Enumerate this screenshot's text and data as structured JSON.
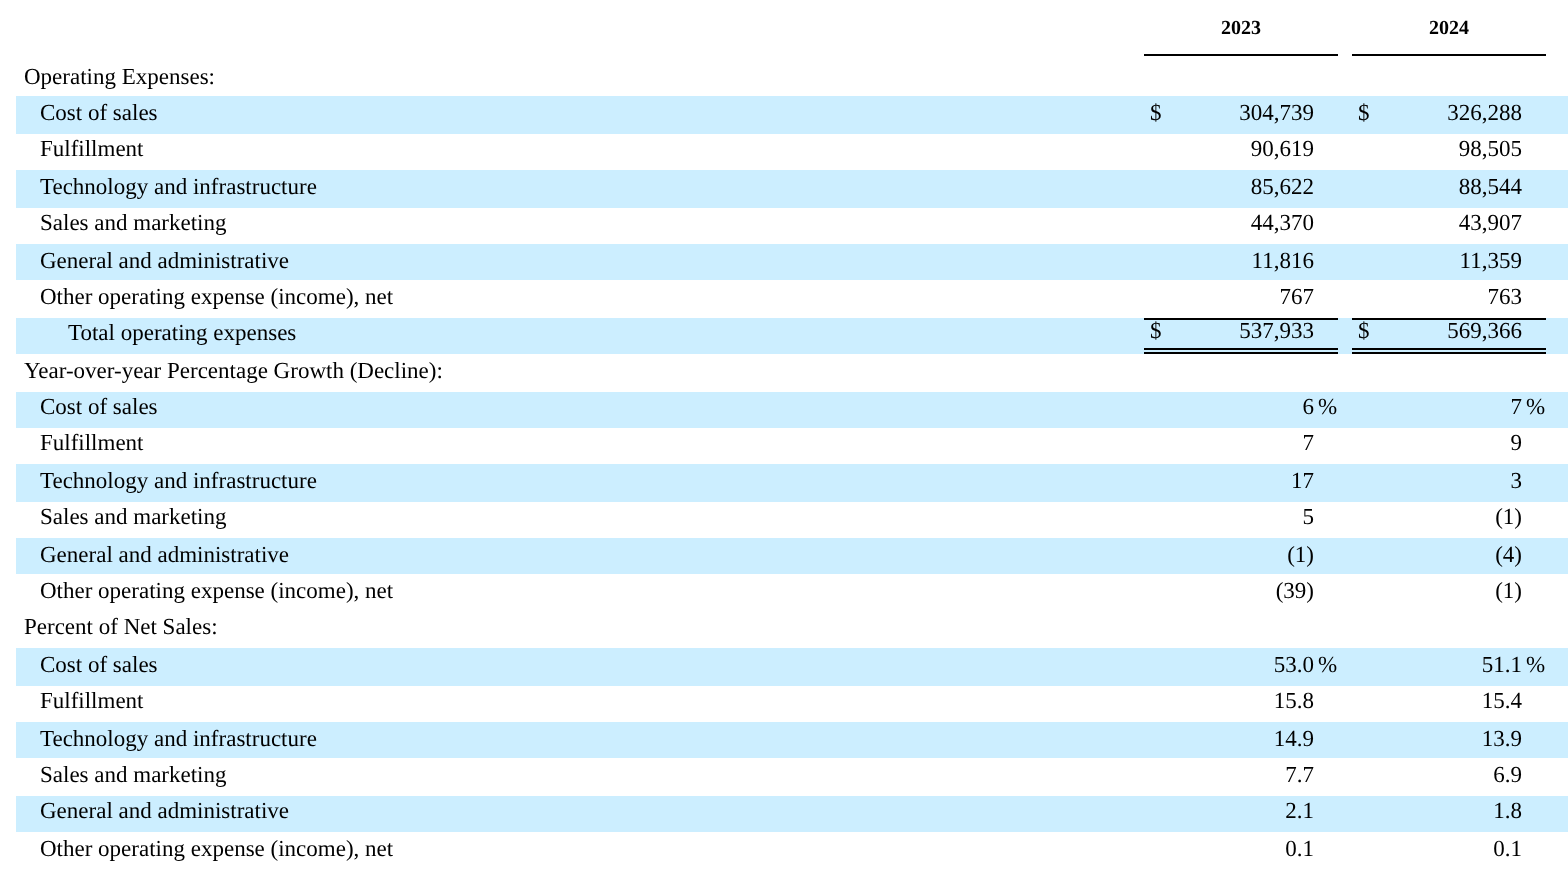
{
  "columns": [
    "2023",
    "2024"
  ],
  "rows": [
    {
      "kind": "section",
      "label": "Operating Expenses:",
      "shaded": false
    },
    {
      "kind": "item",
      "label": "Cost of sales",
      "shaded": true,
      "cells": [
        {
          "currency": "$",
          "value": "304,739"
        },
        {
          "currency": "$",
          "value": "326,288"
        }
      ]
    },
    {
      "kind": "item",
      "label": "Fulfillment",
      "shaded": false,
      "cells": [
        {
          "value": "90,619"
        },
        {
          "value": "98,505"
        }
      ]
    },
    {
      "kind": "item",
      "label": "Technology and infrastructure",
      "shaded": true,
      "cells": [
        {
          "value": "85,622"
        },
        {
          "value": "88,544"
        }
      ]
    },
    {
      "kind": "item",
      "label": "Sales and marketing",
      "shaded": false,
      "cells": [
        {
          "value": "44,370"
        },
        {
          "value": "43,907"
        }
      ]
    },
    {
      "kind": "item",
      "label": "General and administrative",
      "shaded": true,
      "cells": [
        {
          "value": "11,816"
        },
        {
          "value": "11,359"
        }
      ]
    },
    {
      "kind": "item",
      "label": "Other operating expense (income), net",
      "shaded": false,
      "cells": [
        {
          "value": "767"
        },
        {
          "value": "763"
        }
      ]
    },
    {
      "kind": "total",
      "label": "Total operating expenses",
      "shaded": true,
      "cells": [
        {
          "currency": "$",
          "value": "537,933"
        },
        {
          "currency": "$",
          "value": "569,366"
        }
      ]
    },
    {
      "kind": "section",
      "label": "Year-over-year Percentage Growth (Decline):",
      "shaded": false
    },
    {
      "kind": "item",
      "label": "Cost of sales",
      "shaded": true,
      "cells": [
        {
          "value": "6",
          "unit": "%"
        },
        {
          "value": "7",
          "unit": "%"
        }
      ]
    },
    {
      "kind": "item",
      "label": "Fulfillment",
      "shaded": false,
      "cells": [
        {
          "value": "7"
        },
        {
          "value": "9"
        }
      ]
    },
    {
      "kind": "item",
      "label": "Technology and infrastructure",
      "shaded": true,
      "cells": [
        {
          "value": "17"
        },
        {
          "value": "3"
        }
      ]
    },
    {
      "kind": "item",
      "label": "Sales and marketing",
      "shaded": false,
      "cells": [
        {
          "value": "5"
        },
        {
          "value": "(1)"
        }
      ]
    },
    {
      "kind": "item",
      "label": "General and administrative",
      "shaded": true,
      "cells": [
        {
          "value": "(1)"
        },
        {
          "value": "(4)"
        }
      ]
    },
    {
      "kind": "item",
      "label": "Other operating expense (income), net",
      "shaded": false,
      "cells": [
        {
          "value": "(39)"
        },
        {
          "value": "(1)"
        }
      ]
    },
    {
      "kind": "section",
      "label": "Percent of Net Sales:",
      "shaded": false
    },
    {
      "kind": "item",
      "label": "Cost of sales",
      "shaded": true,
      "cells": [
        {
          "value": "53.0",
          "unit": "%"
        },
        {
          "value": "51.1",
          "unit": "%"
        }
      ]
    },
    {
      "kind": "item",
      "label": "Fulfillment",
      "shaded": false,
      "cells": [
        {
          "value": "15.8"
        },
        {
          "value": "15.4"
        }
      ]
    },
    {
      "kind": "item",
      "label": "Technology and infrastructure",
      "shaded": true,
      "cells": [
        {
          "value": "14.9"
        },
        {
          "value": "13.9"
        }
      ]
    },
    {
      "kind": "item",
      "label": "Sales and marketing",
      "shaded": false,
      "cells": [
        {
          "value": "7.7"
        },
        {
          "value": "6.9"
        }
      ]
    },
    {
      "kind": "item",
      "label": "General and administrative",
      "shaded": true,
      "cells": [
        {
          "value": "2.1"
        },
        {
          "value": "1.8"
        }
      ]
    },
    {
      "kind": "item",
      "label": "Other operating expense (income), net",
      "shaded": false,
      "cells": [
        {
          "value": "0.1"
        },
        {
          "value": "0.1"
        }
      ]
    }
  ]
}
